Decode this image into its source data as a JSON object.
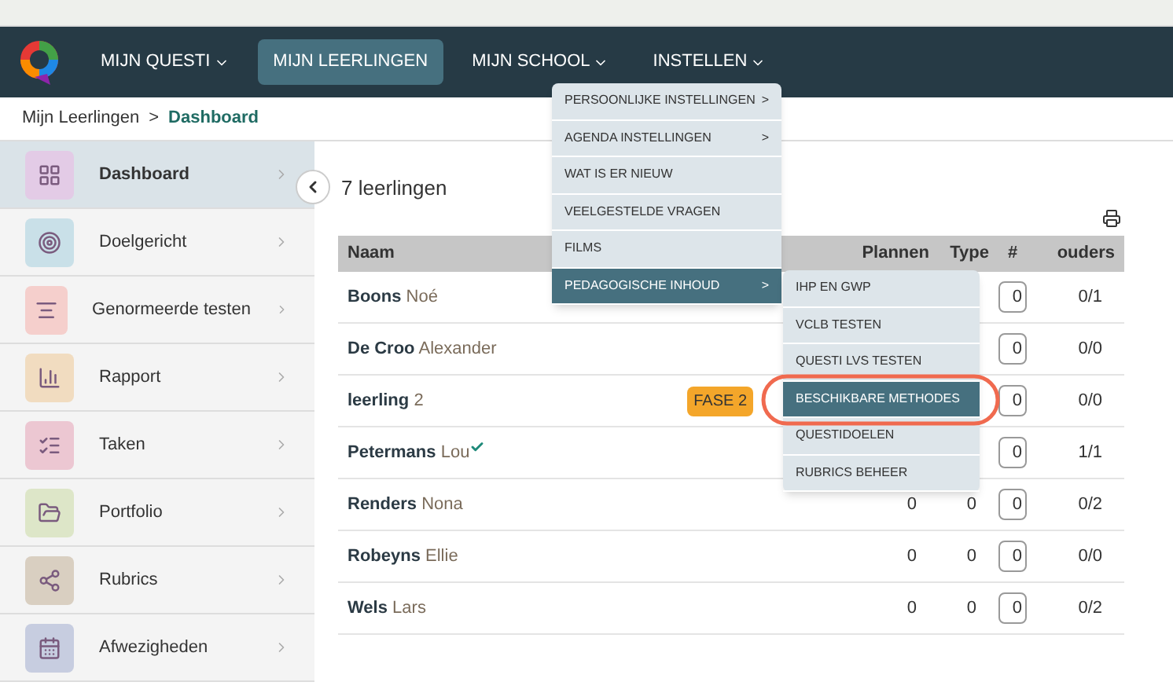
{
  "nav": {
    "items": [
      {
        "label": "MIJN QUESTI",
        "caret": true,
        "selected": false
      },
      {
        "label": "MIJN LEERLINGEN",
        "caret": false,
        "selected": true
      },
      {
        "label": "MIJN SCHOOL",
        "caret": true,
        "selected": false
      },
      {
        "label": "INSTELLEN",
        "caret": true,
        "selected": false
      }
    ]
  },
  "breadcrumb": {
    "parent": "Mijn Leerlingen",
    "separator": ">",
    "current": "Dashboard"
  },
  "sidebar": {
    "items": [
      {
        "label": "Dashboard",
        "color": "#e3cbe6",
        "selected": true
      },
      {
        "label": "Doelgericht",
        "color": "#c9e0e8",
        "selected": false
      },
      {
        "label": "Genormeerde testen",
        "color": "#f5cfcc",
        "selected": false
      },
      {
        "label": "Rapport",
        "color": "#f1dcc0",
        "selected": false
      },
      {
        "label": "Taken",
        "color": "#ecc7d2",
        "selected": false
      },
      {
        "label": "Portfolio",
        "color": "#dde6c8",
        "selected": false
      },
      {
        "label": "Rubrics",
        "color": "#d9cfc1",
        "selected": false
      },
      {
        "label": "Afwezigheden",
        "color": "#c7cde0",
        "selected": false
      }
    ]
  },
  "title": "7 leerlingen",
  "table": {
    "columns": [
      "Naam",
      "Plannen",
      "Type",
      "#",
      "ouders"
    ],
    "rows": [
      {
        "last": "Boons",
        "first": "Noé",
        "verified": false,
        "count": "0",
        "ouders": "0/1"
      },
      {
        "last": "De Croo",
        "first": "Alexander",
        "verified": false,
        "count": "0",
        "ouders": "0/0"
      },
      {
        "last": "leerling",
        "first": "2",
        "verified": false,
        "badge": "FASE 2",
        "count": "0",
        "ouders": "0/0"
      },
      {
        "last": "Petermans",
        "first": "Lou",
        "verified": true,
        "count": "0",
        "ouders": "1/1"
      },
      {
        "last": "Renders",
        "first": "Nona",
        "verified": false,
        "plannen": "0",
        "type": "0",
        "count": "0",
        "ouders": "0/2"
      },
      {
        "last": "Robeyns",
        "first": "Ellie",
        "verified": false,
        "plannen": "0",
        "type": "0",
        "count": "0",
        "ouders": "0/0"
      },
      {
        "last": "Wels",
        "first": "Lars",
        "verified": false,
        "plannen": "0",
        "type": "0",
        "count": "0",
        "ouders": "0/2"
      }
    ]
  },
  "dropdown": {
    "items": [
      {
        "label": "PERSOONLIJKE INSTELLINGEN",
        "arrow": ">",
        "selected": false
      },
      {
        "label": "AGENDA INSTELLINGEN",
        "arrow": ">",
        "selected": false
      },
      {
        "label": "WAT IS ER NIEUW",
        "selected": false
      },
      {
        "label": "VEELGESTELDE VRAGEN",
        "selected": false
      },
      {
        "label": "FILMS",
        "selected": false
      },
      {
        "label": "PEDAGOGISCHE INHOUD",
        "arrow": ">",
        "selected": true
      }
    ]
  },
  "submenu": {
    "items": [
      {
        "label": "IHP EN GWP",
        "selected": false,
        "circled": false
      },
      {
        "label": "VCLB TESTEN",
        "selected": false,
        "circled": false
      },
      {
        "label": "QUESTI LVS TESTEN",
        "selected": false,
        "circled": false
      },
      {
        "label": "BESCHIKBARE METHODES",
        "selected": true,
        "circled": true
      },
      {
        "label": "QUESTIDOELEN",
        "selected": false,
        "circled": false
      },
      {
        "label": "RUBRICS BEHEER",
        "selected": false,
        "circled": false
      }
    ]
  }
}
